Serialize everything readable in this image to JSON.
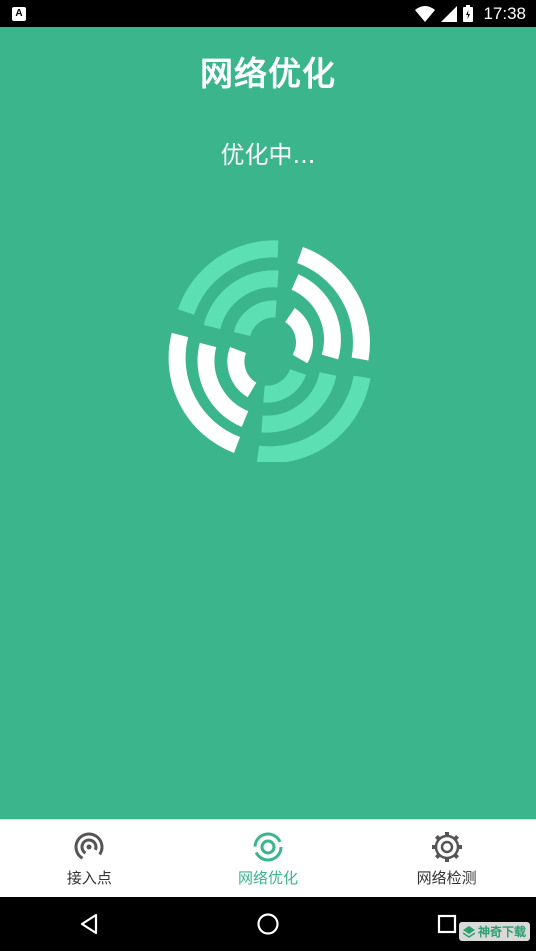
{
  "status_bar": {
    "notification_glyph": "A",
    "time": "17:38"
  },
  "header": {
    "title": "网络优化"
  },
  "main": {
    "status": "优化中..."
  },
  "tabs": [
    {
      "label": "接入点",
      "icon": "hotspot-icon",
      "active": false
    },
    {
      "label": "网络优化",
      "icon": "optimize-icon",
      "active": true
    },
    {
      "label": "网络检测",
      "icon": "gear-icon",
      "active": false
    }
  ],
  "watermark": {
    "text": "神奇下载"
  },
  "colors": {
    "primary": "#3bb58b",
    "radar_light": "#5ce0b3",
    "white": "#ffffff"
  }
}
